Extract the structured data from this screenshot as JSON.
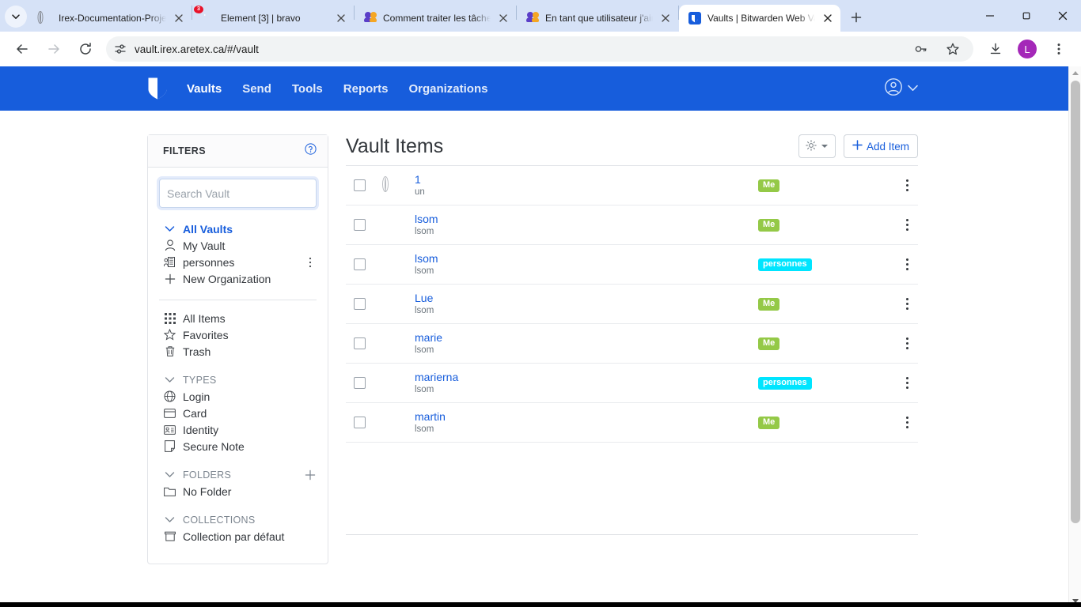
{
  "browser": {
    "tab_search_icon": "chevron-down-icon",
    "tabs": [
      {
        "title": "Irex-Documentation-Project",
        "favicon": "globe-icon",
        "active": false
      },
      {
        "title": "Element [3] | bravo",
        "favicon": "element-icon",
        "badge": "3",
        "active": false
      },
      {
        "title": "Comment traiter les tâches s",
        "favicon": "people-icon",
        "active": false
      },
      {
        "title": "En tant que utilisateur j'aime",
        "favicon": "people-icon",
        "active": false
      },
      {
        "title": "Vaults | Bitwarden Web Vault",
        "favicon": "bitwarden-icon",
        "active": true
      }
    ],
    "new_tab_label": "+",
    "window_controls": {
      "minimize": "−",
      "maximize": "❐",
      "close": "✕"
    },
    "toolbar": {
      "back": "back-icon",
      "forward": "forward-icon",
      "reload": "reload-icon",
      "url": "vault.irex.aretex.ca/#/vault",
      "site_info_icon": "site-settings-icon",
      "password_icon": "key-icon",
      "bookmark_icon": "star-icon",
      "download_icon": "download-icon",
      "profile_initial": "L",
      "menu_icon": "three-dot-menu-icon"
    }
  },
  "app": {
    "brand": "bitwarden-shield-logo",
    "nav": [
      {
        "label": "Vaults",
        "active": true
      },
      {
        "label": "Send",
        "active": false
      },
      {
        "label": "Tools",
        "active": false
      },
      {
        "label": "Reports",
        "active": false
      },
      {
        "label": "Organizations",
        "active": false
      }
    ],
    "account_icon": "account-circle-icon",
    "account_caret": "chevron-down-icon"
  },
  "filters": {
    "title": "FILTERS",
    "help_icon": "question-circle-icon",
    "search": {
      "value": "",
      "placeholder": "Search Vault"
    },
    "vaults": [
      {
        "label": "All Vaults",
        "icon": "chevron-down-icon",
        "selected": true,
        "type": "header-toggle"
      },
      {
        "label": "My Vault",
        "icon": "user-icon",
        "selected": false
      },
      {
        "label": "personnes",
        "icon": "organization-icon",
        "selected": false,
        "trail_icon": "kebab-icon"
      },
      {
        "label": "New Organization",
        "icon": "plus-icon",
        "selected": false
      }
    ],
    "quick": [
      {
        "label": "All Items",
        "icon": "grid-icon"
      },
      {
        "label": "Favorites",
        "icon": "star-icon"
      },
      {
        "label": "Trash",
        "icon": "trash-icon"
      }
    ],
    "types_header": {
      "label": "TYPES",
      "icon": "chevron-down-icon"
    },
    "types": [
      {
        "label": "Login",
        "icon": "globe-icon"
      },
      {
        "label": "Card",
        "icon": "card-icon"
      },
      {
        "label": "Identity",
        "icon": "identity-icon"
      },
      {
        "label": "Secure Note",
        "icon": "note-icon"
      }
    ],
    "folders_header": {
      "label": "FOLDERS",
      "icon": "chevron-down-icon",
      "add_icon": "plus-icon"
    },
    "folders": [
      {
        "label": "No Folder",
        "icon": "folder-icon"
      }
    ],
    "collections_header": {
      "label": "COLLECTIONS",
      "icon": "chevron-down-icon"
    },
    "collections": [
      {
        "label": "Collection par défaut",
        "icon": "collection-icon"
      }
    ]
  },
  "main": {
    "title": "Vault Items",
    "options_button": {
      "icon": "gear-icon",
      "caret": "caret-down-icon"
    },
    "add_item_button": {
      "label": "Add Item",
      "icon": "plus-icon"
    },
    "items": [
      {
        "name": "1",
        "sub": "un",
        "icon": "globe-outline-icon",
        "badge": "Me",
        "badge_kind": "me"
      },
      {
        "name": "lsom",
        "sub": "lsom",
        "icon": "globe-icon",
        "badge": "Me",
        "badge_kind": "me"
      },
      {
        "name": "lsom",
        "sub": "lsom",
        "icon": "globe-icon",
        "badge": "personnes",
        "badge_kind": "org"
      },
      {
        "name": "Lue",
        "sub": "lsom",
        "icon": "globe-icon",
        "badge": "Me",
        "badge_kind": "me"
      },
      {
        "name": "marie",
        "sub": "lsom",
        "icon": "globe-icon",
        "badge": "Me",
        "badge_kind": "me"
      },
      {
        "name": "marierna",
        "sub": "lsom",
        "icon": "globe-icon",
        "badge": "personnes",
        "badge_kind": "org"
      },
      {
        "name": "martin",
        "sub": "lsom",
        "icon": "globe-icon",
        "badge": "Me",
        "badge_kind": "me"
      }
    ],
    "row_menu_icon": "kebab-icon"
  },
  "colors": {
    "brand_blue": "#175ddc",
    "badge_me_green": "#94c947",
    "badge_org_cyan": "#00e5ff",
    "link_blue": "#175ddc",
    "profile_purple": "#a428b8"
  }
}
